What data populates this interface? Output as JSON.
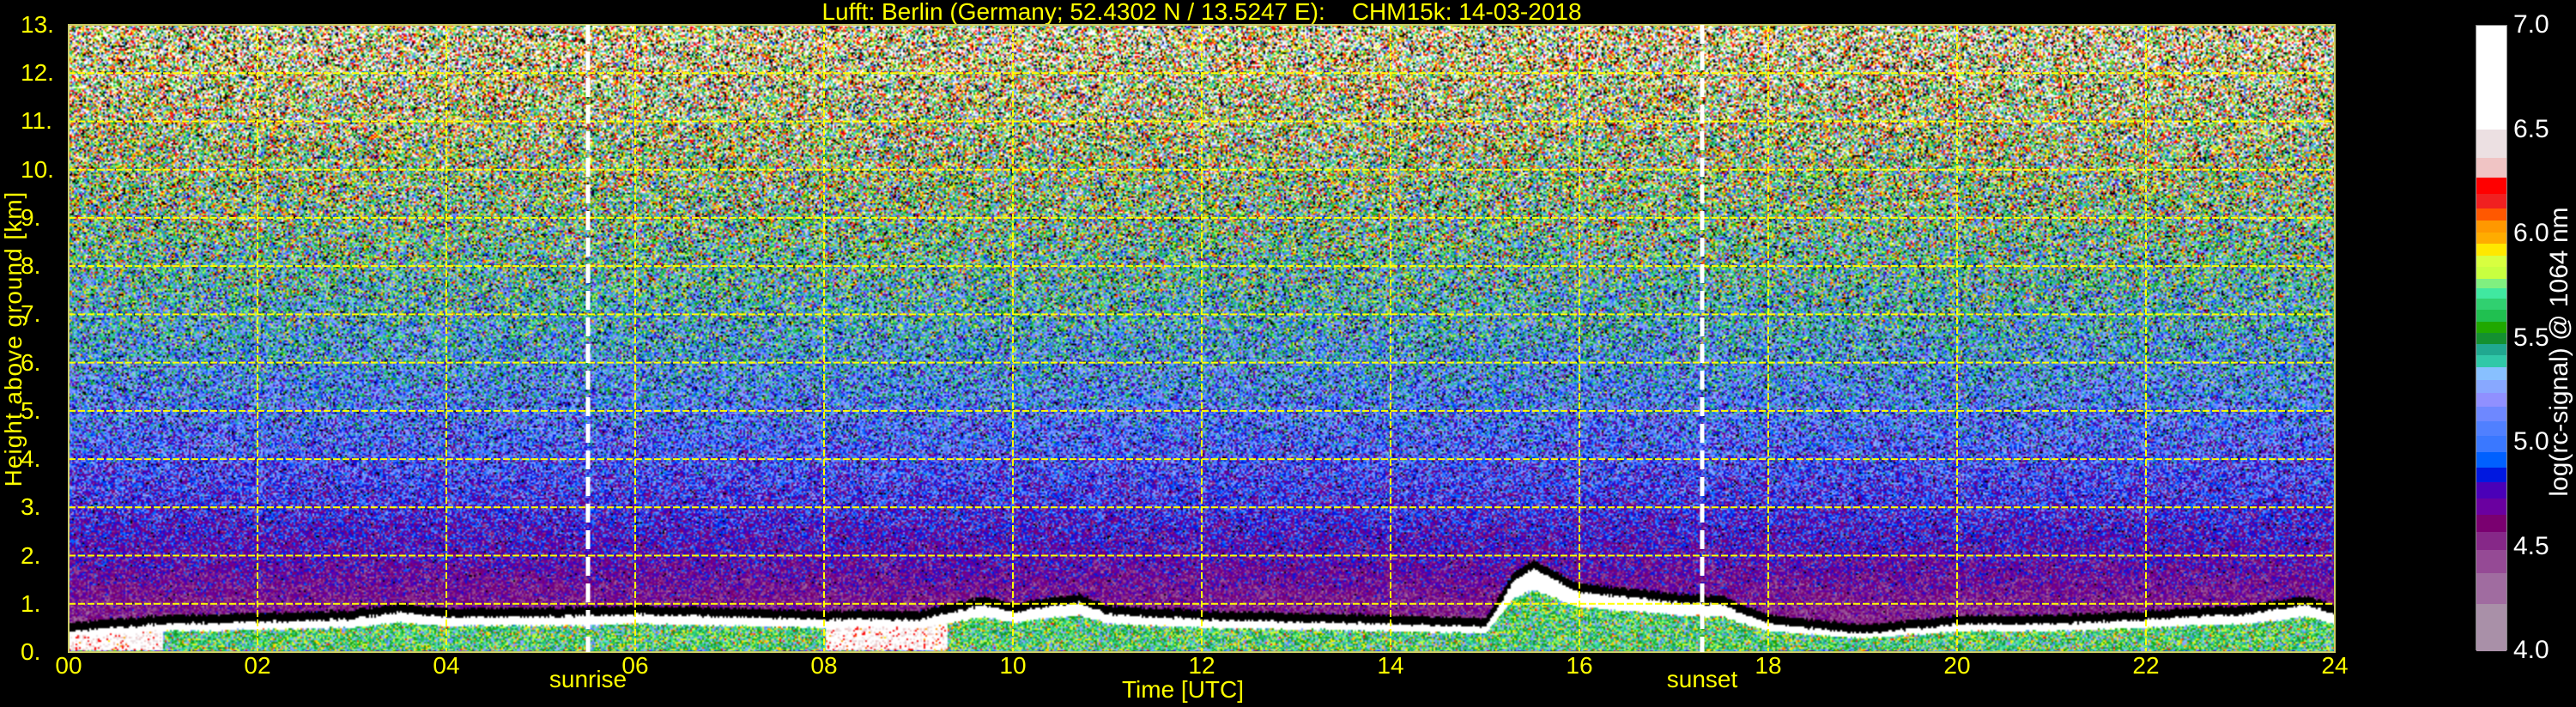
{
  "chart_data": {
    "type": "heatmap",
    "title": "Lufft: Berlin (Germany; 52.4302 N / 13.5247 E):    CHM15k: 14-03-2018",
    "xlabel": "Time [UTC]",
    "ylabel": "Height above ground [km]",
    "xlim": [
      0,
      24
    ],
    "ylim": [
      0,
      13
    ],
    "x_ticks": [
      "00",
      "02",
      "04",
      "06",
      "08",
      "10",
      "12",
      "14",
      "16",
      "18",
      "20",
      "22",
      "24"
    ],
    "y_ticks": [
      "0.",
      "1.",
      "2.",
      "3.",
      "4.",
      "5.",
      "6.",
      "7.",
      "8.",
      "9.",
      "10.",
      "11.",
      "12.",
      "13."
    ],
    "grid": true,
    "grid_color": "#ffff00",
    "events": [
      {
        "label": "sunrise",
        "time_utc": 5.5
      },
      {
        "label": "sunset",
        "time_utc": 17.3
      }
    ],
    "boundary_layer_top_km": {
      "time_utc": [
        0,
        1,
        2,
        3,
        3.5,
        4,
        5,
        6,
        7,
        8,
        9,
        9.7,
        10,
        10.7,
        11,
        12,
        13,
        14,
        15,
        15.3,
        15.5,
        16,
        17,
        17.5,
        18,
        19,
        20,
        21,
        22,
        23,
        23.7,
        24
      ],
      "height": [
        0.45,
        0.6,
        0.65,
        0.7,
        0.85,
        0.75,
        0.75,
        0.8,
        0.75,
        0.7,
        0.7,
        1.0,
        0.85,
        1.05,
        0.8,
        0.7,
        0.65,
        0.6,
        0.55,
        1.5,
        1.75,
        1.25,
        1.05,
        1.0,
        0.6,
        0.4,
        0.6,
        0.6,
        0.7,
        0.8,
        1.0,
        0.8
      ]
    },
    "colorbar": {
      "label": "log(rc-signal) @ 1064 nm",
      "range": [
        4.0,
        7.0
      ],
      "ticks": [
        "4.0",
        "4.5",
        "5.0",
        "5.5",
        "6.0",
        "6.5",
        "7.0"
      ],
      "levels": [
        {
          "from": 4.0,
          "to": 4.227,
          "color": "#a990a8"
        },
        {
          "from": 4.227,
          "to": 4.378,
          "color": "#a06ca0"
        },
        {
          "from": 4.378,
          "to": 4.486,
          "color": "#954a95"
        },
        {
          "from": 4.486,
          "to": 4.573,
          "color": "#862888"
        },
        {
          "from": 4.573,
          "to": 4.655,
          "color": "#7a0070"
        },
        {
          "from": 4.655,
          "to": 4.735,
          "color": "#6a00a0"
        },
        {
          "from": 4.735,
          "to": 4.811,
          "color": "#4a00b8"
        },
        {
          "from": 4.811,
          "to": 4.882,
          "color": "#0018e0"
        },
        {
          "from": 4.882,
          "to": 4.958,
          "color": "#0060ff"
        },
        {
          "from": 4.958,
          "to": 5.033,
          "color": "#3a78ff"
        },
        {
          "from": 5.033,
          "to": 5.105,
          "color": "#5080ff"
        },
        {
          "from": 5.105,
          "to": 5.174,
          "color": "#6e88ff"
        },
        {
          "from": 5.174,
          "to": 5.239,
          "color": "#9090ff"
        },
        {
          "from": 5.239,
          "to": 5.303,
          "color": "#88a8ff"
        },
        {
          "from": 5.303,
          "to": 5.364,
          "color": "#88c0ff"
        },
        {
          "from": 5.364,
          "to": 5.422,
          "color": "#30c8a8"
        },
        {
          "from": 5.422,
          "to": 5.476,
          "color": "#20a890"
        },
        {
          "from": 5.476,
          "to": 5.53,
          "color": "#149030"
        },
        {
          "from": 5.53,
          "to": 5.584,
          "color": "#20a800"
        },
        {
          "from": 5.584,
          "to": 5.638,
          "color": "#20c050"
        },
        {
          "from": 5.638,
          "to": 5.692,
          "color": "#30d070"
        },
        {
          "from": 5.692,
          "to": 5.742,
          "color": "#40e8a0"
        },
        {
          "from": 5.742,
          "to": 5.79,
          "color": "#80f080"
        },
        {
          "from": 5.79,
          "to": 5.844,
          "color": "#c8ff40"
        },
        {
          "from": 5.844,
          "to": 5.898,
          "color": "#d8ff40"
        },
        {
          "from": 5.898,
          "to": 5.956,
          "color": "#ffe800"
        },
        {
          "from": 5.956,
          "to": 6.012,
          "color": "#ffac00"
        },
        {
          "from": 6.012,
          "to": 6.066,
          "color": "#ff9800"
        },
        {
          "from": 6.066,
          "to": 6.125,
          "color": "#ff5800"
        },
        {
          "from": 6.125,
          "to": 6.194,
          "color": "#f02020"
        },
        {
          "from": 6.194,
          "to": 6.272,
          "color": "#ff0000"
        },
        {
          "from": 6.272,
          "to": 6.367,
          "color": "#f0c4c4"
        },
        {
          "from": 6.367,
          "to": 6.503,
          "color": "#ece0e2"
        },
        {
          "from": 6.503,
          "to": 7.0,
          "color": "#ffffff"
        }
      ]
    }
  }
}
